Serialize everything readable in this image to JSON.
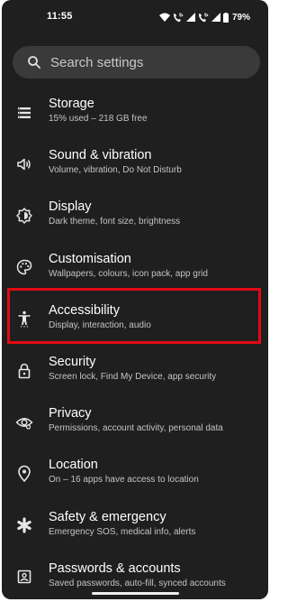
{
  "status_bar": {
    "time": "11:55",
    "battery": "79%"
  },
  "search": {
    "placeholder": "Search settings",
    "icon": "search-icon"
  },
  "settings": [
    {
      "title": "Storage",
      "subtitle": "15% used – 218 GB free",
      "icon": "storage-icon"
    },
    {
      "title": "Sound & vibration",
      "subtitle": "Volume, vibration, Do Not Disturb",
      "icon": "volume-icon"
    },
    {
      "title": "Display",
      "subtitle": "Dark theme, font size, brightness",
      "icon": "brightness-icon"
    },
    {
      "title": "Customisation",
      "subtitle": "Wallpapers, colours, icon pack, app grid",
      "icon": "palette-icon"
    },
    {
      "title": "Accessibility",
      "subtitle": "Display, interaction, audio",
      "icon": "accessibility-icon"
    },
    {
      "title": "Security",
      "subtitle": "Screen lock, Find My Device, app security",
      "icon": "lock-icon"
    },
    {
      "title": "Privacy",
      "subtitle": "Permissions, account activity, personal data",
      "icon": "eye-icon"
    },
    {
      "title": "Location",
      "subtitle": "On – 16 apps have access to location",
      "icon": "location-pin-icon"
    },
    {
      "title": "Safety & emergency",
      "subtitle": "Emergency SOS, medical info, alerts",
      "icon": "asterisk-icon"
    },
    {
      "title": "Passwords & accounts",
      "subtitle": "Saved passwords, auto-fill, synced accounts",
      "icon": "account-box-icon"
    }
  ],
  "highlight": {
    "target": "Accessibility",
    "color": "#e20a14"
  },
  "colors": {
    "background": "#1f1f1f",
    "search_background": "#3a3a3a",
    "text_primary": "#ffffff",
    "text_secondary": "#c4c4c4"
  }
}
